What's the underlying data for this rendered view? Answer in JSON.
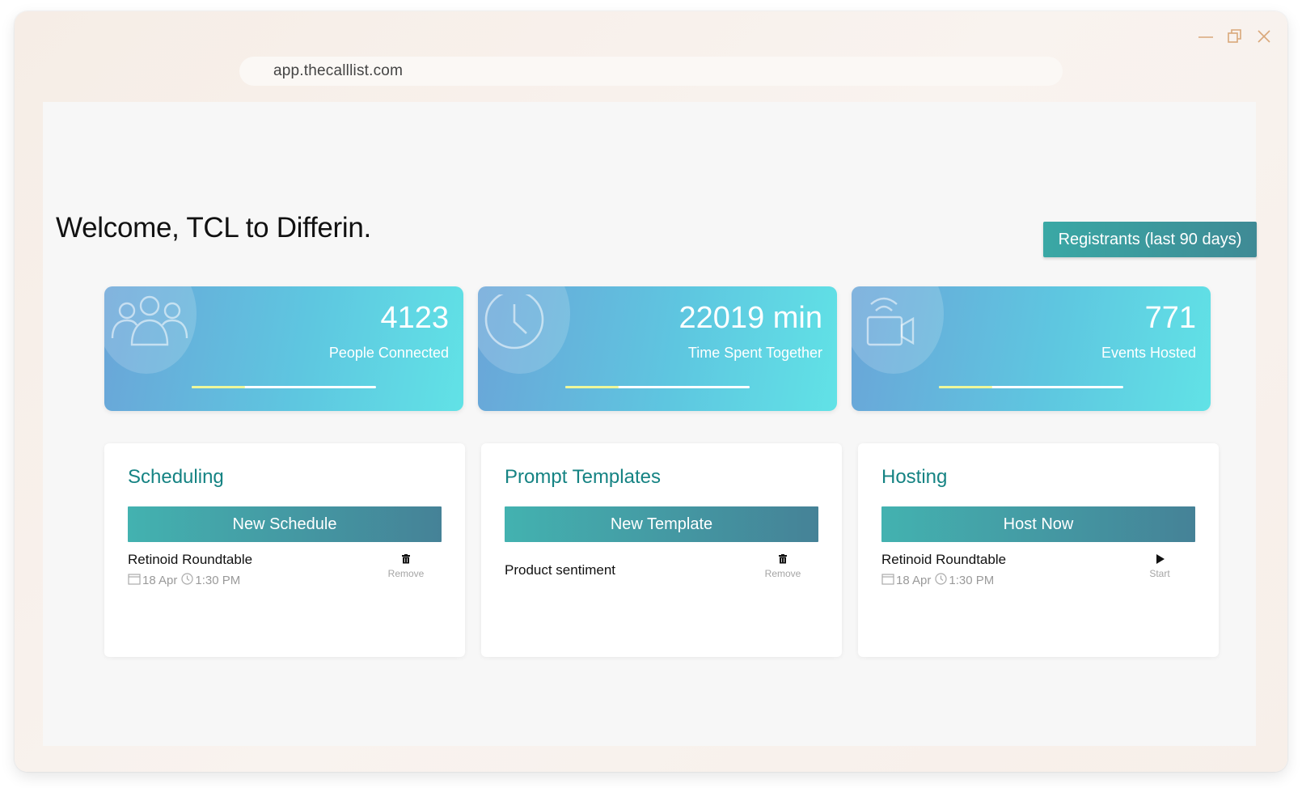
{
  "browser": {
    "url": "app.thecalllist.com"
  },
  "header": {
    "welcome": "Welcome, TCL to Differin.",
    "registrants_button": "Registrants (last 90 days)"
  },
  "stats": [
    {
      "value": "4123",
      "label": "People Connected",
      "progress": 0.29,
      "icon": "people-icon"
    },
    {
      "value": "22019 min",
      "label": "Time Spent Together",
      "progress": 0.29,
      "icon": "clock-icon"
    },
    {
      "value": "771",
      "label": "Events Hosted",
      "progress": 0.29,
      "icon": "video-camera-icon"
    }
  ],
  "panels": {
    "scheduling": {
      "title": "Scheduling",
      "button": "New Schedule",
      "item": {
        "name": "Retinoid Roundtable",
        "date": "18 Apr",
        "time": "1:30 PM",
        "action": "Remove"
      }
    },
    "templates": {
      "title": "Prompt Templates",
      "button": "New Template",
      "item": {
        "name": "Product sentiment",
        "action": "Remove"
      }
    },
    "hosting": {
      "title": "Hosting",
      "button": "Host Now",
      "item": {
        "name": "Retinoid Roundtable",
        "date": "18 Apr",
        "time": "1:30 PM",
        "action": "Start"
      }
    }
  },
  "colors": {
    "accent_teal": "#158383",
    "button_start": "#43b2b0",
    "button_end": "#458297",
    "card_start": "#6aa5d8",
    "card_end": "#61e2e6",
    "window_control": "#d9a87a"
  }
}
